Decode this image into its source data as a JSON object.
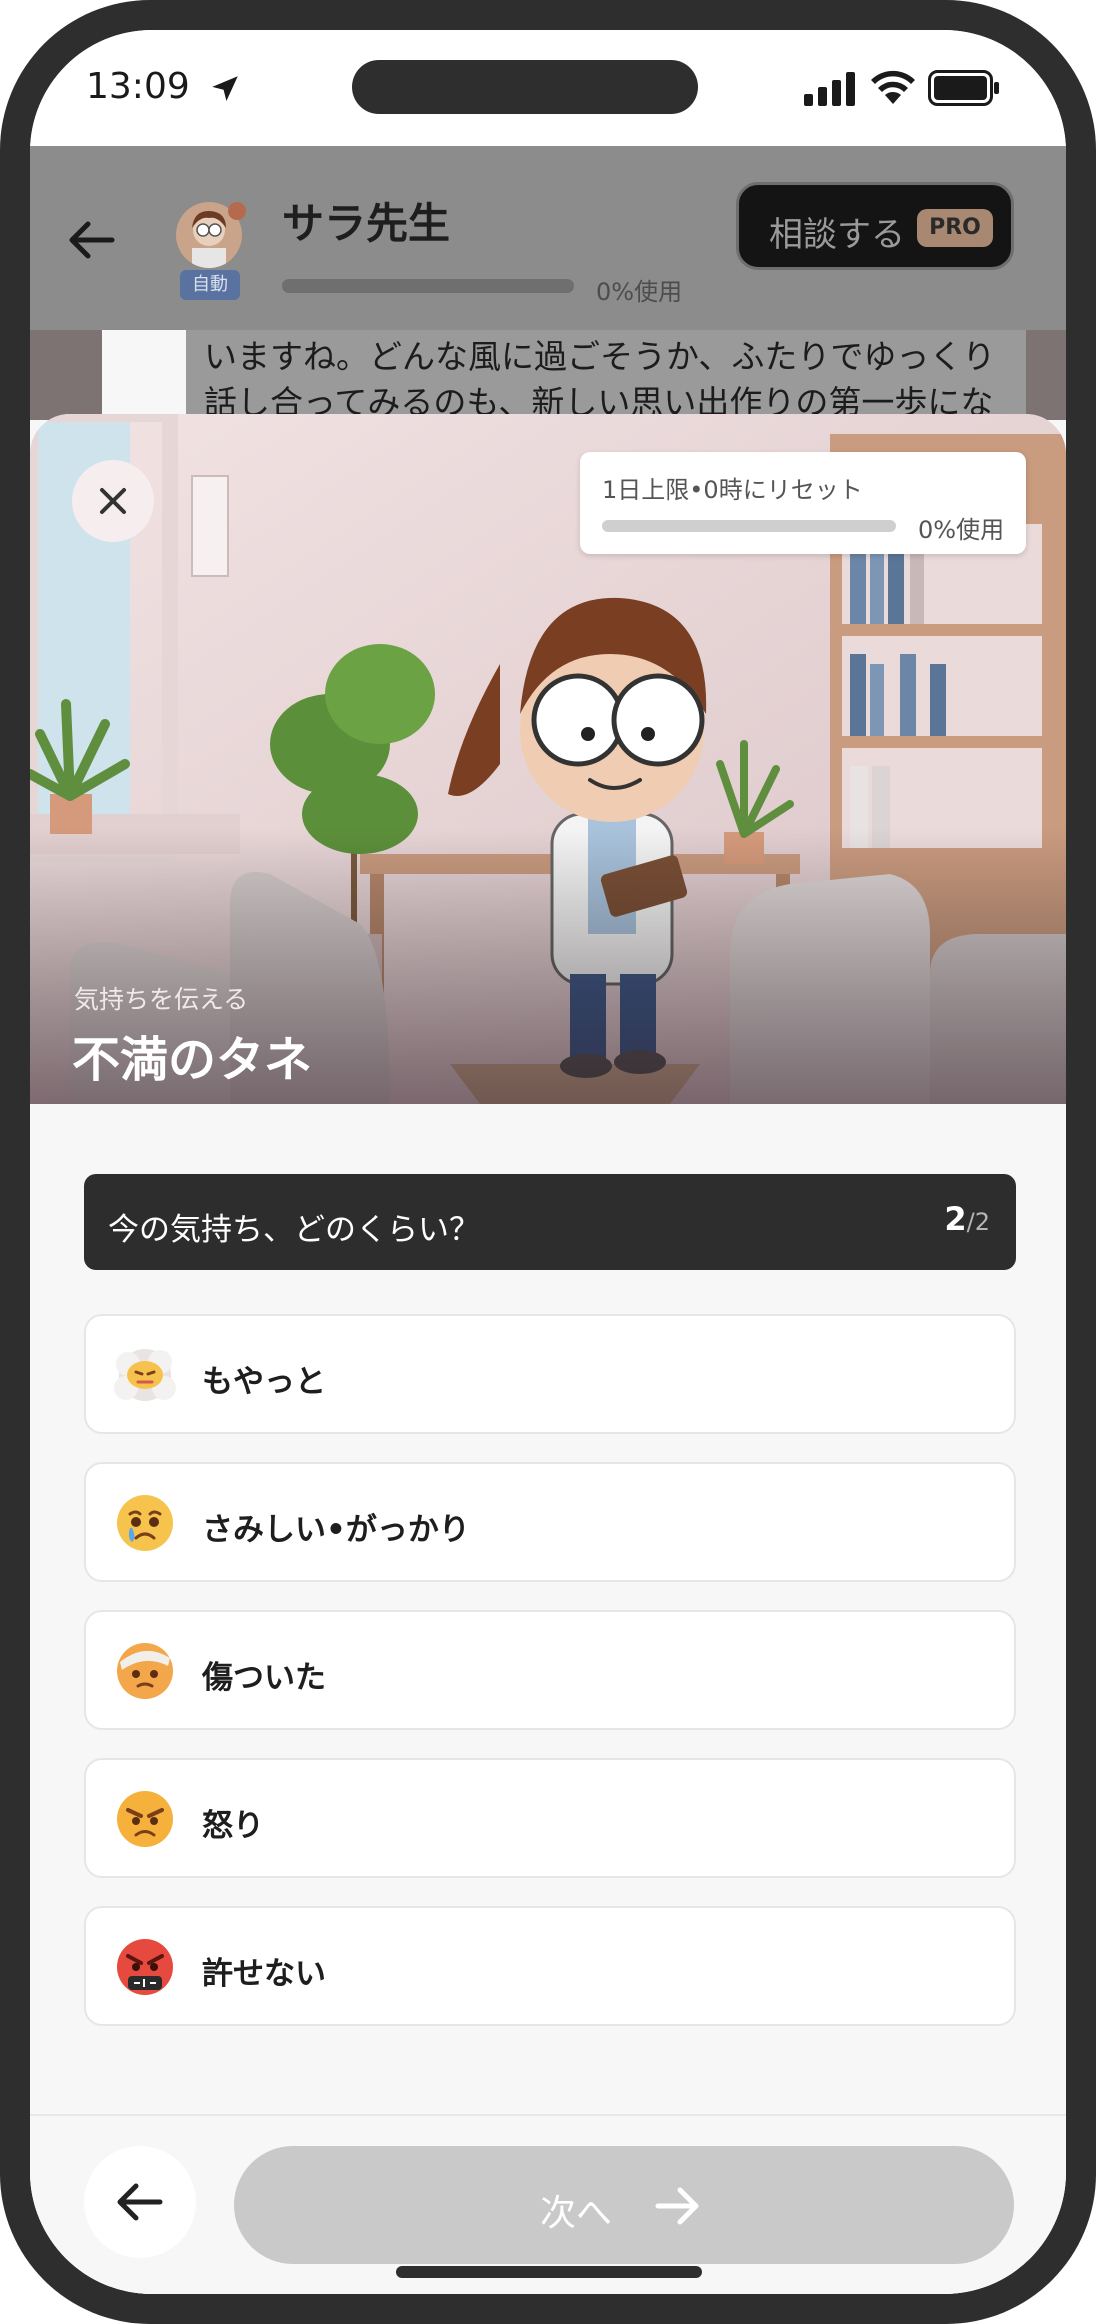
{
  "status_bar": {
    "time": "13:09"
  },
  "chat_header": {
    "teacher_name": "サラ先生",
    "auto_badge": "自動",
    "usage": "0%使用",
    "usage_fraction": 0,
    "consult_button": "相談する",
    "pro_badge": "PRO"
  },
  "chat_message": {
    "text": "いますね。どんな風に過ごそうか、ふたりでゆっくり話し合ってみるのも、新しい思い出作りの第一歩になるかもしれません。お互いの気持ちを少しずつ伝え合"
  },
  "hero": {
    "limit_label": "1日上限•0時にリセット",
    "limit_usage": "0%使用",
    "limit_fraction": 0,
    "subtitle": "気持ちを伝える",
    "title": "不満のタネ"
  },
  "question": {
    "text": "今の気持ち、どのくらい？",
    "step_current": "2",
    "step_separator": "/",
    "step_total": "2"
  },
  "options": [
    {
      "label": "もやっと",
      "icon": "fog-face-icon"
    },
    {
      "label": "さみしい•がっかり",
      "icon": "crying-face-icon"
    },
    {
      "label": "傷ついた",
      "icon": "bandaged-face-icon"
    },
    {
      "label": "怒り",
      "icon": "angry-face-icon"
    },
    {
      "label": "許せない",
      "icon": "cursing-face-icon"
    }
  ],
  "footer": {
    "next_label": "次へ"
  },
  "colors": {
    "frame": "#2e2e2e",
    "question_bar": "#2d2d2d",
    "next_button_disabled": "#c9c9c9",
    "sheet_background": "#f7f7f7"
  }
}
